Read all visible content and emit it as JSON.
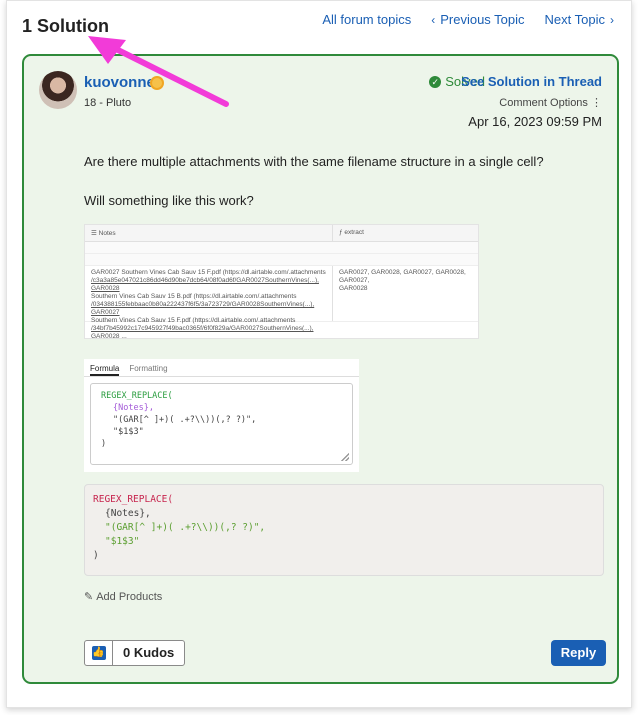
{
  "heading": "1 Solution",
  "nav": {
    "all_topics": "All forum topics",
    "prev_topic": "Previous Topic",
    "next_topic": "Next Topic",
    "prev_chevron": "‹",
    "next_chevron": "›"
  },
  "post": {
    "author": "kuovonne",
    "rank": "18 - Pluto",
    "solved_label": "Solved",
    "solved_check": "✓",
    "see_solution": "See Solution in Thread",
    "comment_options": "Comment Options",
    "comment_options_dots": "⋮",
    "timestamp": "Apr 16, 2023 09:59 PM",
    "para1": "Are there multiple attachments with the same filename structure in a single cell?",
    "para2": "Will something like this work?"
  },
  "screenshot_table": {
    "col1_header": "Notes",
    "col2_header": "extract",
    "cell1_lines": [
      "GAR0027 Southern Vines Cab Sauv 15 F.pdf (https://dl.airtable.com/.attachments",
      "/c3a3a85e047021c86dd46d90be7dcb64/08f0ad6f/GAR0027SouthernVines(...), GAR0028",
      "Southern Vines Cab Sauv 15 B.pdf (https://dl.airtable.com/.attachments",
      "/034388155febbaac0b80a222437f6f5/3a723729/GAR0028SouthernVines(...), GAR0027",
      "Southern Vines Cab Sauv 15 F.pdf (https://dl.airtable.com/.attachments",
      "/34bf7b45992c17c945927f49bac0365f/6f0f829a/GAR0027SouthernVines(...), GAR0028 ..."
    ],
    "cell2_lines": [
      "GAR0027, GAR0028, GAR0027, GAR0028, GAR0027,",
      "GAR0028"
    ]
  },
  "formula_panel": {
    "tab_formula": "Formula",
    "tab_formatting": "Formatting",
    "line1": "REGEX_REPLACE(",
    "line2": "{Notes},",
    "line3": "\"(GAR[^ ]+)( .+?\\\\))(,? ?)\",",
    "line4": "\"$1$3\"",
    "line5": ")"
  },
  "code_block": {
    "line1": "REGEX_REPLACE(",
    "line2": "{Notes},",
    "line3": "\"(GAR[^ ]+)( .+?\\\\))(,? ?)\",",
    "line4": "\"$1$3\"",
    "line5": ")"
  },
  "add_products": "Add Products",
  "kudos": {
    "count_label": "0 Kudos"
  },
  "reply_label": "Reply",
  "colors": {
    "accent": "#1a5fb4",
    "solved_green": "#2f8a3a",
    "card_bg": "#edf5ea",
    "arrow": "#f23bd8"
  }
}
